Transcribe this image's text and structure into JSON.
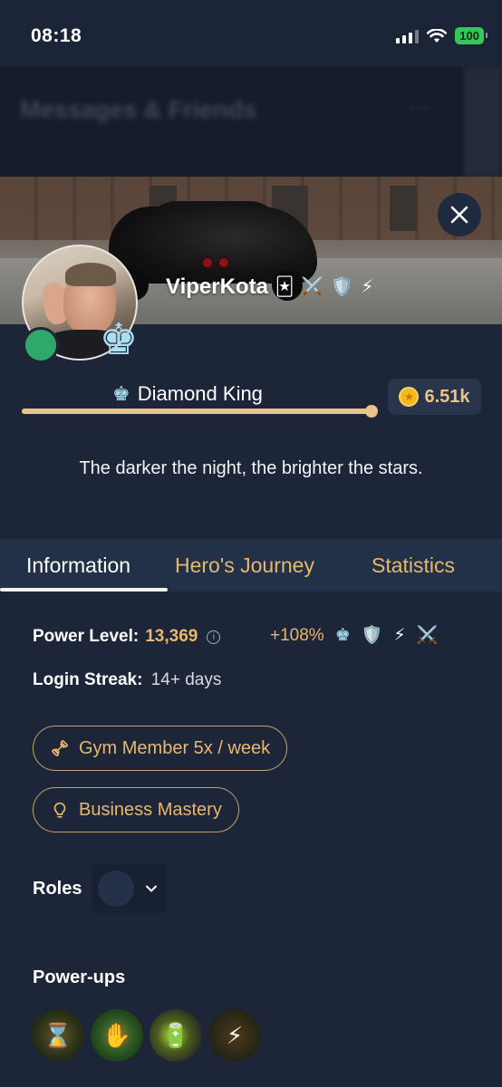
{
  "status_bar": {
    "time": "08:18",
    "battery": "100"
  },
  "background_header": {
    "title": "Messages & Friends",
    "menu": "···"
  },
  "profile": {
    "username": "ViperKota",
    "username_badges": [
      "🃏",
      "⚔️",
      "🛡️",
      "⚡"
    ],
    "rank_icon": "♚",
    "rank_name": "Diamond King",
    "rank_progress": 0.99,
    "coins": "6.51k",
    "coin_icon": "★",
    "online": true,
    "bio": "The darker the night, the brighter the stars."
  },
  "tabs": [
    {
      "label": "Information",
      "active": true
    },
    {
      "label": "Hero's Journey",
      "active": false
    },
    {
      "label": "Statistics",
      "active": false
    }
  ],
  "info": {
    "power_level_label": "Power Level:",
    "power_level_value": "13,369",
    "info_icon": "i",
    "boost_text": "+108%",
    "boost_icons": [
      "♚",
      "🛡️",
      "⚡",
      "⚔️"
    ],
    "login_streak_label": "Login Streak:",
    "login_streak_value": "14+ days",
    "tags": [
      {
        "label": "Gym Member 5x / week",
        "icon": "dumbbell-icon"
      },
      {
        "label": "Business Mastery",
        "icon": "lightbulb-icon"
      }
    ],
    "roles_label": "Roles",
    "powerups_label": "Power-ups",
    "powerups": [
      "hourglass-powerup",
      "hand-powerup",
      "battery-powerup",
      "circuit-powerup"
    ]
  },
  "colors": {
    "background": "#1c2638",
    "accent_gold": "#e8b76e",
    "tab_bar": "#223148",
    "rank_icon": "#a9dff0",
    "online": "#2fa86a"
  }
}
